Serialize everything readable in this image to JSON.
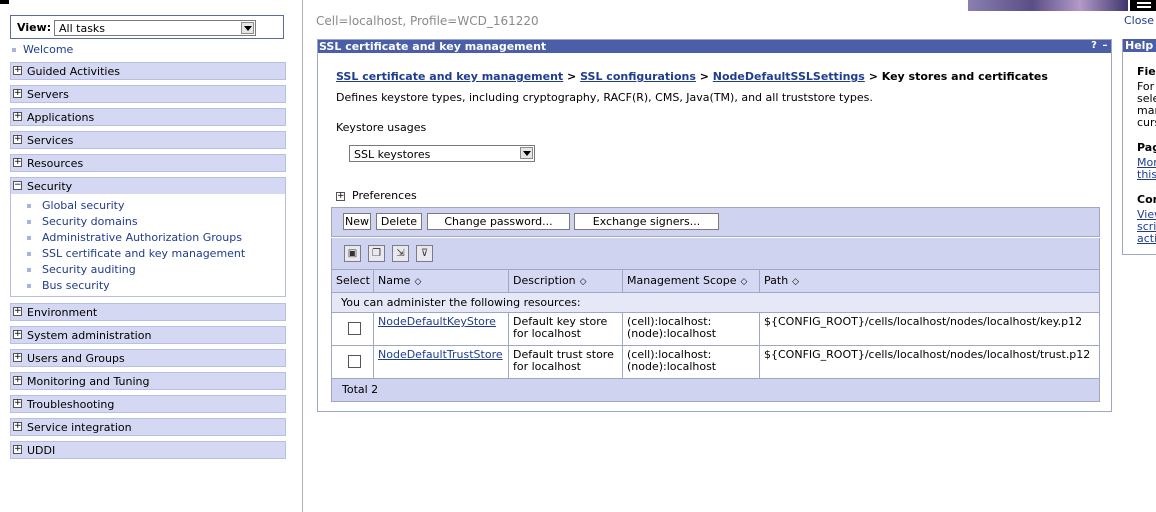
{
  "header": {
    "cell_profile": "Cell=localhost, Profile=WCD_161220",
    "close_label": "Close"
  },
  "nav": {
    "view_label": "View:",
    "view_value": "All tasks",
    "welcome": "Welcome",
    "items": [
      "Guided Activities",
      "Servers",
      "Applications",
      "Services",
      "Resources",
      "Security",
      "Environment",
      "System administration",
      "Users and Groups",
      "Monitoring and Tuning",
      "Troubleshooting",
      "Service integration",
      "UDDI"
    ],
    "security_children": [
      "Global security",
      "Security domains",
      "Administrative Authorization Groups",
      "SSL certificate and key management",
      "Security auditing",
      "Bus security"
    ]
  },
  "portlet": {
    "title": "SSL certificate and key management",
    "breadcrumb": {
      "link1": "SSL certificate and key management",
      "link2": "SSL configurations",
      "link3": "NodeDefaultSSLSettings",
      "current": "Key stores and certificates",
      "sep": ">"
    },
    "description": "Defines keystore types, including cryptography, RACF(R), CMS, Java(TM), and all truststore types.",
    "keystore_usages_label": "Keystore usages",
    "keystore_usages_value": "SSL keystores",
    "preferences_label": "Preferences",
    "buttons": {
      "new": "New",
      "delete": "Delete",
      "change_password": "Change password...",
      "exchange_signers": "Exchange signers..."
    },
    "table": {
      "headers": {
        "select": "Select",
        "name": "Name",
        "description": "Description",
        "scope": "Management Scope",
        "path": "Path"
      },
      "resources_note": "You can administer the following resources:",
      "rows": [
        {
          "name": "NodeDefaultKeyStore",
          "desc1": "Default key store",
          "desc2": "for localhost",
          "scope1": "(cell):localhost:",
          "scope2": "(node):localhost",
          "path": "${CONFIG_ROOT}/cells/localhost/nodes/localhost/key.p12"
        },
        {
          "name": "NodeDefaultTrustStore",
          "desc1": "Default trust store",
          "desc2": "for localhost",
          "scope1": "(cell):localhost:",
          "scope2": "(node):localhost",
          "path": "${CONFIG_ROOT}/cells/localhost/nodes/localhost/trust.p12"
        }
      ],
      "total": "Total 2"
    }
  },
  "help": {
    "title": "Help",
    "field_label": "Fiel",
    "lines": [
      "For",
      "sele",
      "mar",
      "curs"
    ],
    "page_label": "Pag",
    "page_links": [
      "Mor",
      "this"
    ],
    "command_label": "Con",
    "command_links": [
      "View",
      "scri",
      "acti"
    ]
  }
}
